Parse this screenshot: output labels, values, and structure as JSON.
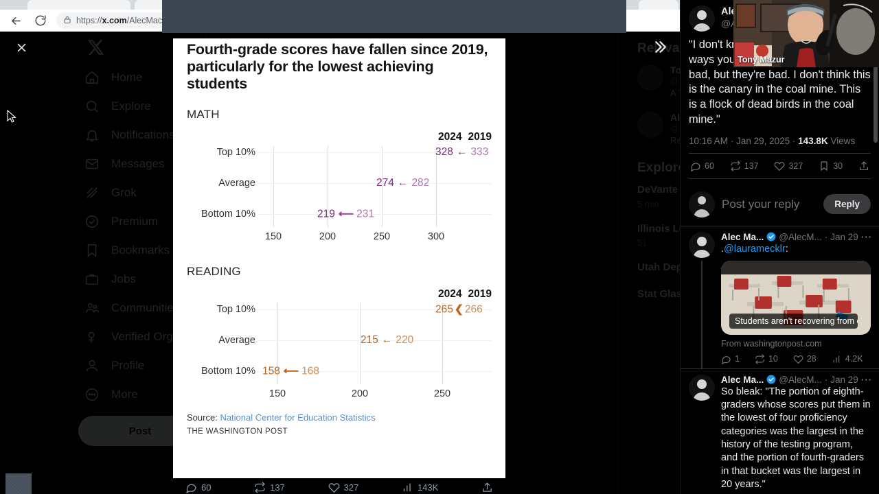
{
  "browser": {
    "url_prefix": "https://",
    "url_domain": "x.com",
    "url_path": "/AlecMac",
    "back_icon": "back-arrow-icon",
    "reload_icon": "reload-icon",
    "lock_icon": "lock-icon",
    "extensions_icon": "extensions-puzzle-icon",
    "menu_icon": "more-options-icon",
    "profile_icon": "profile-avatar-icon"
  },
  "sidebar": {
    "logo": "x-logo-icon",
    "items": [
      {
        "label": "Home",
        "icon": "home-icon"
      },
      {
        "label": "Explore",
        "icon": "search-icon"
      },
      {
        "label": "Notifications",
        "icon": "bell-icon"
      },
      {
        "label": "Messages",
        "icon": "envelope-icon"
      },
      {
        "label": "Grok",
        "icon": "grok-icon"
      },
      {
        "label": "Premium",
        "icon": "premium-badge-icon"
      },
      {
        "label": "Bookmarks",
        "icon": "bookmark-icon"
      },
      {
        "label": "Jobs",
        "icon": "briefcase-icon"
      },
      {
        "label": "Communities",
        "icon": "communities-icon"
      },
      {
        "label": "Verified Orgs",
        "icon": "verified-org-icon"
      },
      {
        "label": "Profile",
        "icon": "person-icon"
      },
      {
        "label": "More",
        "icon": "more-circle-icon"
      }
    ],
    "post_button": "Post"
  },
  "right_rail": {
    "relevant_people_heading": "Relevant people",
    "people": [
      {
        "name": "Tony Mazur",
        "handle": "@tonymazur",
        "bio": "A Thursday Night Football guy. For fun."
      },
      {
        "name": "Alec Mac...",
        "handle": "@AlecMacG",
        "bio": "Reporter, @washingtonpost"
      }
    ],
    "explore_heading": "Explore",
    "trends": [
      {
        "title": "DeVante Parker Announced to Auditors",
        "meta": "5 min"
      },
      {
        "title": "Illinois Lobbying on Economic Ignite B...",
        "meta": "51"
      },
      {
        "title": "Utah Department Outage and Outdoor",
        "meta": ""
      },
      {
        "title": "Stat Glass Winner",
        "meta": ""
      }
    ]
  },
  "graphic": {
    "title": "Fourth-grade scores have fallen since 2019, particularly for the lowest achieving students",
    "source_label": "Source:",
    "source_link": "National Center for Education Statistics",
    "credit": "THE WASHINGTON POST",
    "col_2024": "2024",
    "col_2019": "2019"
  },
  "chart_data": [
    {
      "type": "bar",
      "title": "MATH",
      "chart_label": "MATH",
      "color_2024": "#7d2a7d",
      "color_2019": "#b277b2",
      "categories": [
        "Top 10%",
        "Average",
        "Bottom 10%"
      ],
      "series": [
        {
          "name": "2024",
          "values": [
            328,
            274,
            219
          ]
        },
        {
          "name": "2019",
          "values": [
            333,
            282,
            231
          ]
        }
      ],
      "labels_2024": [
        "328",
        "274",
        "219"
      ],
      "labels_2019": [
        "333",
        "282",
        "231"
      ],
      "xticks": [
        150,
        200,
        250,
        300
      ],
      "xtick_labels": [
        "150",
        "200",
        "250",
        "300"
      ],
      "xlim": [
        140,
        345
      ],
      "xlabel": "",
      "ylabel": "",
      "grid": true,
      "legend": [
        "2024",
        "2019"
      ],
      "legend_position": "top-right"
    },
    {
      "type": "bar",
      "title": "READING",
      "chart_label": "READING",
      "color_2024": "#b8651f",
      "color_2019": "#cf8e53",
      "categories": [
        "Top 10%",
        "Average",
        "Bottom 10%"
      ],
      "series": [
        {
          "name": "2024",
          "values": [
            265,
            215,
            158
          ]
        },
        {
          "name": "2019",
          "values": [
            266,
            220,
            168
          ]
        }
      ],
      "labels_2024": [
        "265",
        "215",
        "158"
      ],
      "labels_2019": [
        "266",
        "220",
        "168"
      ],
      "xticks": [
        150,
        200,
        250
      ],
      "xtick_labels": [
        "150",
        "200",
        "250"
      ],
      "xlim": [
        140,
        280
      ],
      "xlabel": "",
      "ylabel": "",
      "grid": true,
      "legend": [
        "2024",
        "2019"
      ],
      "legend_position": "top-right"
    }
  ],
  "tweet_panel": {
    "main_tweet": {
      "author_name": "Alec",
      "author_handle": "@Ale",
      "text": "\"I don't know how many different ways you can say these results are bad, but they're bad. I don't think this is the canary in the coal mine. This is a flock of dead birds in the coal mine.\"",
      "time": "10:16 AM",
      "date": "Jan 29, 2025",
      "views_count": "143.8K",
      "views_label": "Views",
      "replies": "60",
      "reposts": "137",
      "likes": "327",
      "bookmarks": "30",
      "share_icon": "share-icon"
    },
    "reply_composer": {
      "placeholder": "Post your reply",
      "button": "Reply"
    },
    "replies": [
      {
        "author_name": "Alec Ma...",
        "author_handle": "@AlecM...",
        "date": "Jan 29",
        "text_prefix": ".",
        "mention": "@lauramecklr",
        "text_suffix": ":",
        "link_card_caption": "Students aren't recovering from c...",
        "link_card_source": "From washingtonpost.com",
        "replies": "1",
        "reposts": "10",
        "likes": "28",
        "views": "4.2K"
      },
      {
        "author_name": "Alec Ma...",
        "author_handle": "@AlecM...",
        "date": "Jan 29",
        "text": "So bleak: \"The portion of eighth-graders whose scores put them in the lowest of four proficiency categories was the largest in the history of the testing program, and the portion of fourth-graders in that bucket was the largest in 20 years.\""
      }
    ]
  },
  "bottom_bar": {
    "replies": "60",
    "reposts": "137",
    "likes": "327",
    "views": "143K",
    "share_icon": "share-icon"
  },
  "overlay": {
    "webcam_name": "Tony Mazur",
    "close_icon": "close-icon",
    "expand_icon": "double-chevron-right-icon"
  }
}
